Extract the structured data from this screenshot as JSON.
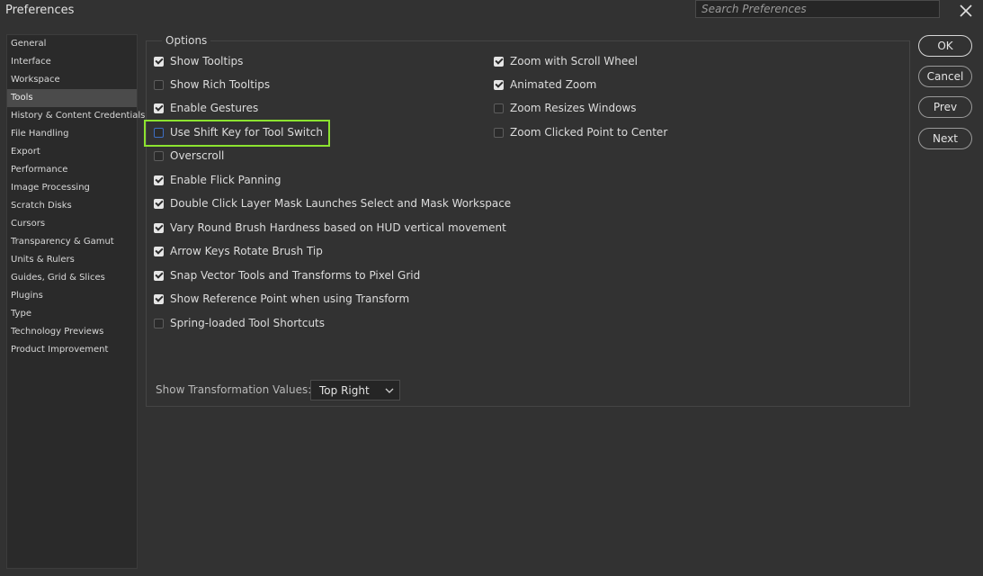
{
  "window": {
    "title": "Preferences",
    "search_placeholder": "Search Preferences"
  },
  "sidebar": {
    "items": [
      {
        "label": "General"
      },
      {
        "label": "Interface"
      },
      {
        "label": "Workspace"
      },
      {
        "label": "Tools",
        "active": true
      },
      {
        "label": "History & Content Credentials"
      },
      {
        "label": "File Handling"
      },
      {
        "label": "Export"
      },
      {
        "label": "Performance"
      },
      {
        "label": "Image Processing"
      },
      {
        "label": "Scratch Disks"
      },
      {
        "label": "Cursors"
      },
      {
        "label": "Transparency & Gamut"
      },
      {
        "label": "Units & Rulers"
      },
      {
        "label": "Guides, Grid & Slices"
      },
      {
        "label": "Plugins"
      },
      {
        "label": "Type"
      },
      {
        "label": "Technology Previews"
      },
      {
        "label": "Product Improvement"
      }
    ]
  },
  "options": {
    "legend": "Options",
    "left": [
      {
        "label": "Show Tooltips",
        "checked": true
      },
      {
        "label": "Show Rich Tooltips",
        "checked": false
      },
      {
        "label": "Enable Gestures",
        "checked": true
      },
      {
        "label": "Use Shift Key for Tool Switch",
        "checked": false
      },
      {
        "label": "Overscroll",
        "checked": false
      },
      {
        "label": "Enable Flick Panning",
        "checked": true
      },
      {
        "label": "Double Click Layer Mask Launches Select and Mask Workspace",
        "checked": true
      },
      {
        "label": "Vary Round Brush Hardness based on HUD vertical movement",
        "checked": true
      },
      {
        "label": "Arrow Keys Rotate Brush Tip",
        "checked": true
      },
      {
        "label": "Snap Vector Tools and Transforms to Pixel Grid",
        "checked": true
      },
      {
        "label": "Show Reference Point when using Transform",
        "checked": true
      },
      {
        "label": "Spring-loaded Tool Shortcuts",
        "checked": false
      }
    ],
    "right": [
      {
        "label": "Zoom with Scroll Wheel",
        "checked": true
      },
      {
        "label": "Animated Zoom",
        "checked": true
      },
      {
        "label": "Zoom Resizes Windows",
        "checked": false
      },
      {
        "label": "Zoom Clicked Point to Center",
        "checked": false
      }
    ],
    "transformation_label": "Show Transformation Values:",
    "transformation_value": "Top Right"
  },
  "buttons": {
    "ok": "OK",
    "cancel": "Cancel",
    "prev": "Prev",
    "next": "Next"
  },
  "colors": {
    "highlight": "#8ce32f",
    "focus_ring": "#3d6fc4"
  }
}
